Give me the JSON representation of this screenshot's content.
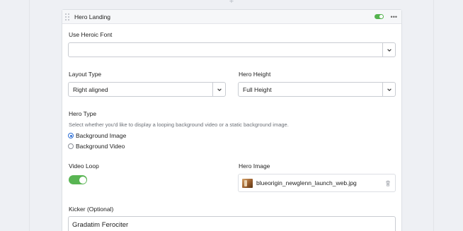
{
  "block": {
    "title": "Hero Landing",
    "enabled": true
  },
  "fields": {
    "heroic_font": {
      "label": "Use Heroic Font",
      "value": ""
    },
    "layout_type": {
      "label": "Layout Type",
      "value": "Right aligned"
    },
    "hero_height": {
      "label": "Hero Height",
      "value": "Full Height"
    },
    "hero_type": {
      "label": "Hero Type",
      "helper": "Select whether you'd like to display a looping background video or a static background image.",
      "options": [
        {
          "label": "Background Image",
          "checked": true
        },
        {
          "label": "Background Video",
          "checked": false
        }
      ]
    },
    "video_loop": {
      "label": "Video Loop",
      "on": true
    },
    "hero_image": {
      "label": "Hero Image",
      "file_name": "blueorigin_newglenn_launch_web.jpg"
    },
    "kicker": {
      "label": "Kicker (Optional)",
      "value": "Gradatim Ferociter"
    }
  },
  "colors": {
    "toggle_on": "#55b34f",
    "radio_selected": "#2c6ed5",
    "background": "#eef0f4"
  },
  "icons": [
    "plus-icon",
    "drag-handle-icon",
    "more-icon",
    "chevron-down-icon",
    "trash-icon"
  ]
}
